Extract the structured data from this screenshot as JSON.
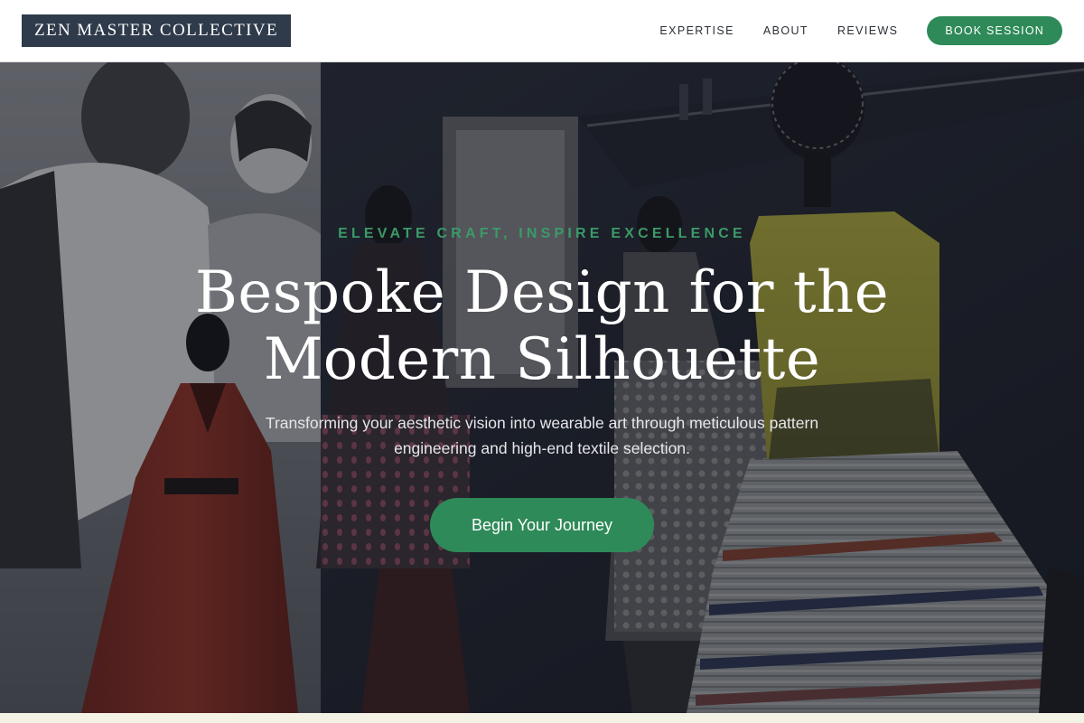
{
  "header": {
    "logo_text": "ZEN MASTER COLLECTIVE",
    "nav": [
      "EXPERTISE",
      "ABOUT",
      "REVIEWS"
    ],
    "book_label": "BOOK SESSION"
  },
  "hero": {
    "eyebrow": "ELEVATE CRAFT, INSPIRE EXCELLENCE",
    "headline": "Bespoke Design for the Modern Silhouette",
    "subtext": "Transforming your aesthetic vision into wearable art through meticulous pattern engineering and high-end textile selection.",
    "cta_label": "Begin Your Journey"
  },
  "colors": {
    "accent": "#2e8a58",
    "logo_bg": "#2f3a4b",
    "next_section_bg": "#f3f2e4"
  }
}
